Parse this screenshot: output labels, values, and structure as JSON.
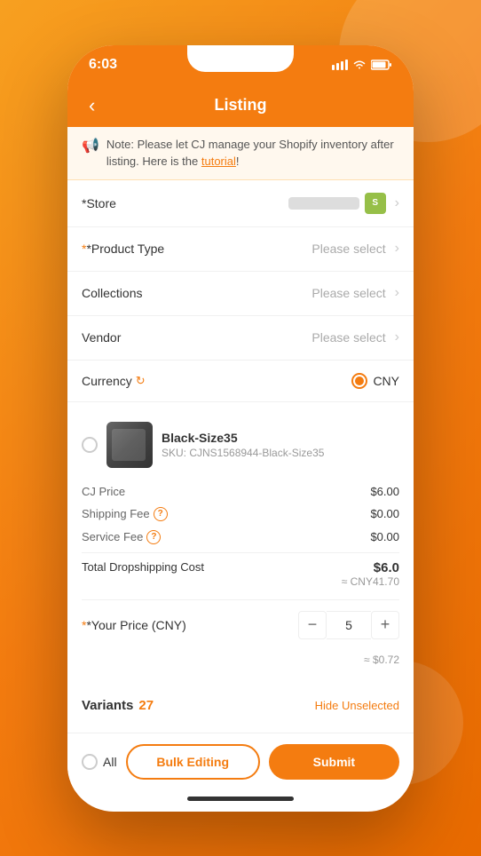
{
  "status_bar": {
    "time": "6:03"
  },
  "nav": {
    "title": "Listing",
    "back_label": "‹"
  },
  "notice": {
    "text": "Note: Please let CJ manage your Shopify inventory after listing. Here is the",
    "link_text": "tutorial",
    "suffix": "!"
  },
  "form": {
    "store_label": "*Store",
    "product_type_label": "*Product Type",
    "product_type_placeholder": "Please select",
    "collections_label": "Collections",
    "collections_placeholder": "Please select",
    "vendor_label": "Vendor",
    "vendor_placeholder": "Please select",
    "currency_label": "Currency",
    "currency_value": "CNY"
  },
  "product": {
    "name": "Black-Size35",
    "sku": "SKU: CJNS1568944-Black-Size35",
    "cj_price_label": "CJ Price",
    "cj_price_value": "$6.00",
    "shipping_fee_label": "Shipping Fee",
    "shipping_fee_value": "$0.00",
    "service_fee_label": "Service Fee",
    "service_fee_value": "$0.00",
    "total_label": "Total Dropshipping Cost",
    "total_usd": "$6.0",
    "total_cny": "≈ CNY41.70",
    "your_price_label": "*Your Price (CNY)",
    "your_price_value": "5",
    "approx_usd": "≈ $0.72",
    "stepper_minus": "−",
    "stepper_plus": "+"
  },
  "variants": {
    "title": "Variants",
    "count": "27",
    "hide_label": "Hide Unselected"
  },
  "bottom": {
    "all_label": "All",
    "bulk_label": "Bulk Editing",
    "submit_label": "Submit"
  }
}
